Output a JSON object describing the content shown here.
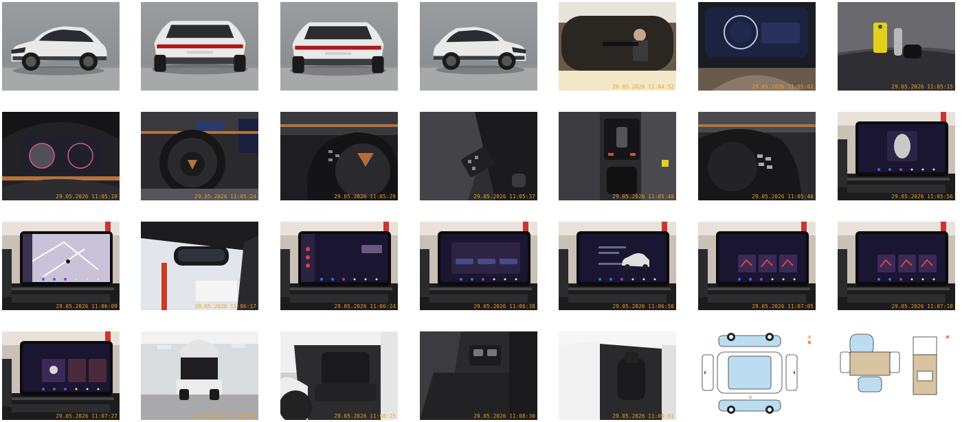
{
  "timestamp_color": "#f0a020",
  "colors": {
    "car_white": "#e9e9e9",
    "studio_grey": "#8c8f92",
    "screen_dark": "#1a1530",
    "dash_black": "#1c1c1e",
    "interior": "#3a3a3d",
    "copper": "#b8723c",
    "diagram_blue": "#bcdcf2",
    "diagram_tan": "#d8c4a0",
    "marker_orange": "#f28a5a",
    "marker_tan": "#e9c99b"
  },
  "photos": [
    {
      "kind": "car-front-34",
      "timestamp": ""
    },
    {
      "kind": "car-rear-34-left",
      "timestamp": ""
    },
    {
      "kind": "car-rear-34-right",
      "timestamp": ""
    },
    {
      "kind": "car-side-front",
      "timestamp": ""
    },
    {
      "kind": "mirror-selfie",
      "timestamp": "29.05.2026 11:04:52"
    },
    {
      "kind": "instrument-cluster-dark",
      "timestamp": "29.05.2026 11:05:02"
    },
    {
      "kind": "keys-on-seat",
      "timestamp": "29.05.2026 11:05:15"
    },
    {
      "kind": "instrument-cluster",
      "timestamp": "29.05.2026 11:05:19"
    },
    {
      "kind": "steering-wheel",
      "timestamp": "29.05.2026 11:05:24"
    },
    {
      "kind": "steering-wheel-left-buttons",
      "timestamp": "29.05.2026 11:05:29"
    },
    {
      "kind": "door-panel",
      "timestamp": "29.05.2026 11:05:37"
    },
    {
      "kind": "center-console",
      "timestamp": "29.05.2026 11:05:40"
    },
    {
      "kind": "steering-wheel-right-buttons",
      "timestamp": "29.05.2026 11:05:46"
    },
    {
      "kind": "infotainment-car-view",
      "timestamp": "29.05.2026 11:05:56"
    },
    {
      "kind": "infotainment-map",
      "timestamp": "29.05.2026 11:06:09"
    },
    {
      "kind": "rear-view-mirror",
      "timestamp": "29.05.2026 11:06:17"
    },
    {
      "kind": "infotainment-menu",
      "timestamp": "29.05.2026 11:06:24"
    },
    {
      "kind": "infotainment-dialog",
      "timestamp": "29.05.2026 11:06:38"
    },
    {
      "kind": "infotainment-service",
      "timestamp": "29.05.2026 11:06:50"
    },
    {
      "kind": "infotainment-assist",
      "timestamp": "29.05.2026 11:07:05"
    },
    {
      "kind": "infotainment-assist-2",
      "timestamp": "29.05.2026 11:07:10"
    },
    {
      "kind": "infotainment-vehicle",
      "timestamp": "29.05.2026 11:07:27"
    },
    {
      "kind": "open-trunk",
      "timestamp": "29.05.2026 11:08:10"
    },
    {
      "kind": "rear-seats",
      "timestamp": "29.05.2026 11:08:25"
    },
    {
      "kind": "rear-floor",
      "timestamp": "29.05.2026 11:08:30"
    },
    {
      "kind": "front-seats-door-open",
      "timestamp": "29.05.2026 11:09:01"
    },
    {
      "kind": "damage-diagram-exterior",
      "timestamp": ""
    },
    {
      "kind": "damage-diagram-interior",
      "timestamp": ""
    }
  ]
}
